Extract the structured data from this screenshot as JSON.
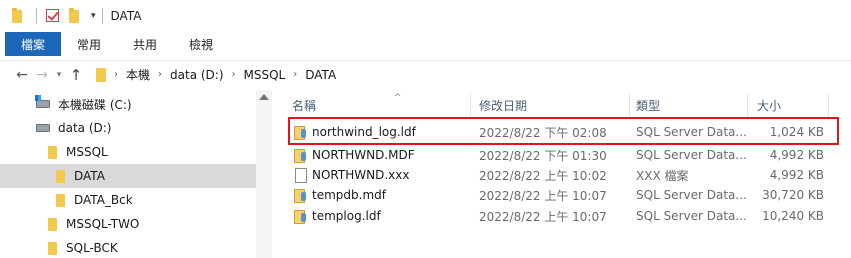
{
  "titlebar": {
    "title": "DATA",
    "qa_dropdown": "▾"
  },
  "ribbon": {
    "tabs": [
      "檔案",
      "常用",
      "共用",
      "檢視"
    ]
  },
  "address": {
    "back": "←",
    "forward": "→",
    "history": "▾",
    "up": "↑",
    "crumbs": [
      "本機",
      "data (D:)",
      "MSSQL",
      "DATA"
    ],
    "separator": "›"
  },
  "nav": {
    "items": [
      {
        "label": "本機磁碟 (C:)",
        "icon": "system-drive-icon"
      },
      {
        "label": "data (D:)",
        "icon": "drive-icon"
      },
      {
        "label": "MSSQL",
        "icon": "folder-icon"
      },
      {
        "label": "DATA",
        "icon": "folder-icon",
        "selected": true
      },
      {
        "label": "DATA_Bck",
        "icon": "folder-icon"
      },
      {
        "label": "MSSQL-TWO",
        "icon": "folder-icon"
      },
      {
        "label": "SQL-BCK",
        "icon": "folder-icon"
      }
    ]
  },
  "filelist": {
    "headers": {
      "name": "名稱",
      "date": "修改日期",
      "type": "類型",
      "size": "大小"
    },
    "sort_indicator": "^",
    "rows": [
      {
        "name": "northwind_log.ldf",
        "date": "2022/8/22 下午 02:08",
        "type": "SQL Server Data...",
        "size": "1,024 KB",
        "icon": "database-file-icon"
      },
      {
        "name": "NORTHWND.MDF",
        "date": "2022/8/22 下午 01:30",
        "type": "SQL Server Data...",
        "size": "4,992 KB",
        "icon": "database-file-icon"
      },
      {
        "name": "NORTHWND.xxx",
        "date": "2022/8/22 上午 10:02",
        "type": "XXX 檔案",
        "size": "4,992 KB",
        "icon": "blank-file-icon"
      },
      {
        "name": "tempdb.mdf",
        "date": "2022/8/22 上午 10:07",
        "type": "SQL Server Data...",
        "size": "30,720 KB",
        "icon": "database-file-icon"
      },
      {
        "name": "templog.ldf",
        "date": "2022/8/22 上午 10:07",
        "type": "SQL Server Data...",
        "size": "10,240 KB",
        "icon": "database-file-icon"
      }
    ]
  },
  "colors": {
    "file_tab": "#1c67b7",
    "highlight": "#e0161e",
    "folder": "#f2c94c",
    "selected_nav": "#d9d9d9",
    "header_text": "#4c607a"
  }
}
